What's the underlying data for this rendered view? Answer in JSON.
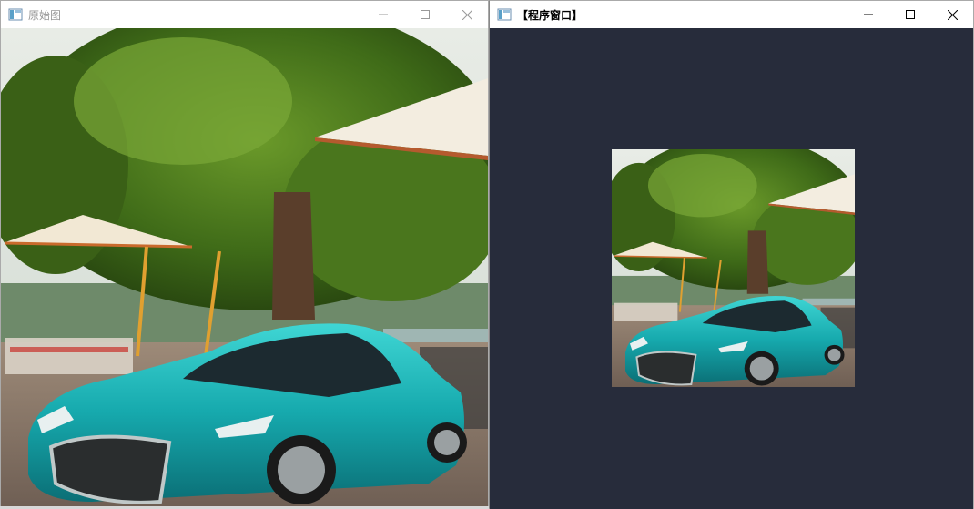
{
  "windows": {
    "original": {
      "title": "原始图",
      "controls": {
        "minimize": "minimize-icon",
        "maximize": "maximize-icon",
        "close": "close-icon"
      },
      "image": {
        "description_icon": "photo-car-under-tree"
      }
    },
    "program": {
      "title": "【程序窗口】",
      "background_color": "#272c3b",
      "controls": {
        "minimize": "minimize-icon",
        "maximize": "maximize-icon",
        "close": "close-icon"
      },
      "image": {
        "description_icon": "photo-car-under-tree-scaled"
      }
    }
  },
  "colors": {
    "car_teal": "#1fb5b8",
    "tree_green": "#4d7a1c",
    "sky": "#dfe6e0",
    "umbrella": "#f2ece0",
    "ground": "#8e7a6a"
  }
}
